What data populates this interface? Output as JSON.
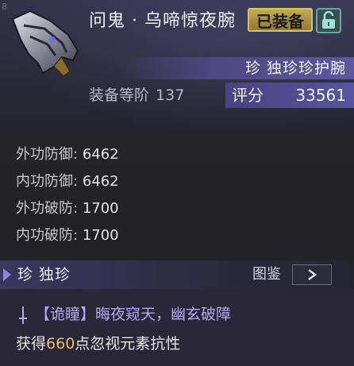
{
  "corner_text": "8",
  "item": {
    "name": "问鬼 · 乌啼惊夜腕",
    "equipped_label": "已装备",
    "type_label": "珍 独珍珍护腕",
    "tier_label": "装备等阶",
    "tier_value": "137",
    "score_label": "评分",
    "score_value": "33561"
  },
  "stats": [
    {
      "label": "外功防御:",
      "value": "6462"
    },
    {
      "label": "内功防御:",
      "value": "6462"
    },
    {
      "label": "外功破防:",
      "value": "1700"
    },
    {
      "label": "内功破防:",
      "value": "1700"
    }
  ],
  "rarity": {
    "label": "珍  独珍",
    "atlas_label": "图鉴"
  },
  "effect": {
    "title": "【诡瞳】晦夜窥天，幽玄破障",
    "desc_prefix": "获得",
    "desc_number": "660",
    "desc_suffix": "点忽视元素抗性"
  },
  "colors": {
    "accent_purple": "#5f58a0",
    "badge_gold": "#c3aa55",
    "effect_title": "#b6a8f2",
    "effect_number": "#e2c06c"
  },
  "icons": {
    "item_icon": "gauntlet-icon",
    "lock_icon": "unlock-icon",
    "rarity_icon": "rarity-marker-icon",
    "atlas_icon": "chevron-right-icon",
    "effect_icon": "dagger-icon"
  }
}
